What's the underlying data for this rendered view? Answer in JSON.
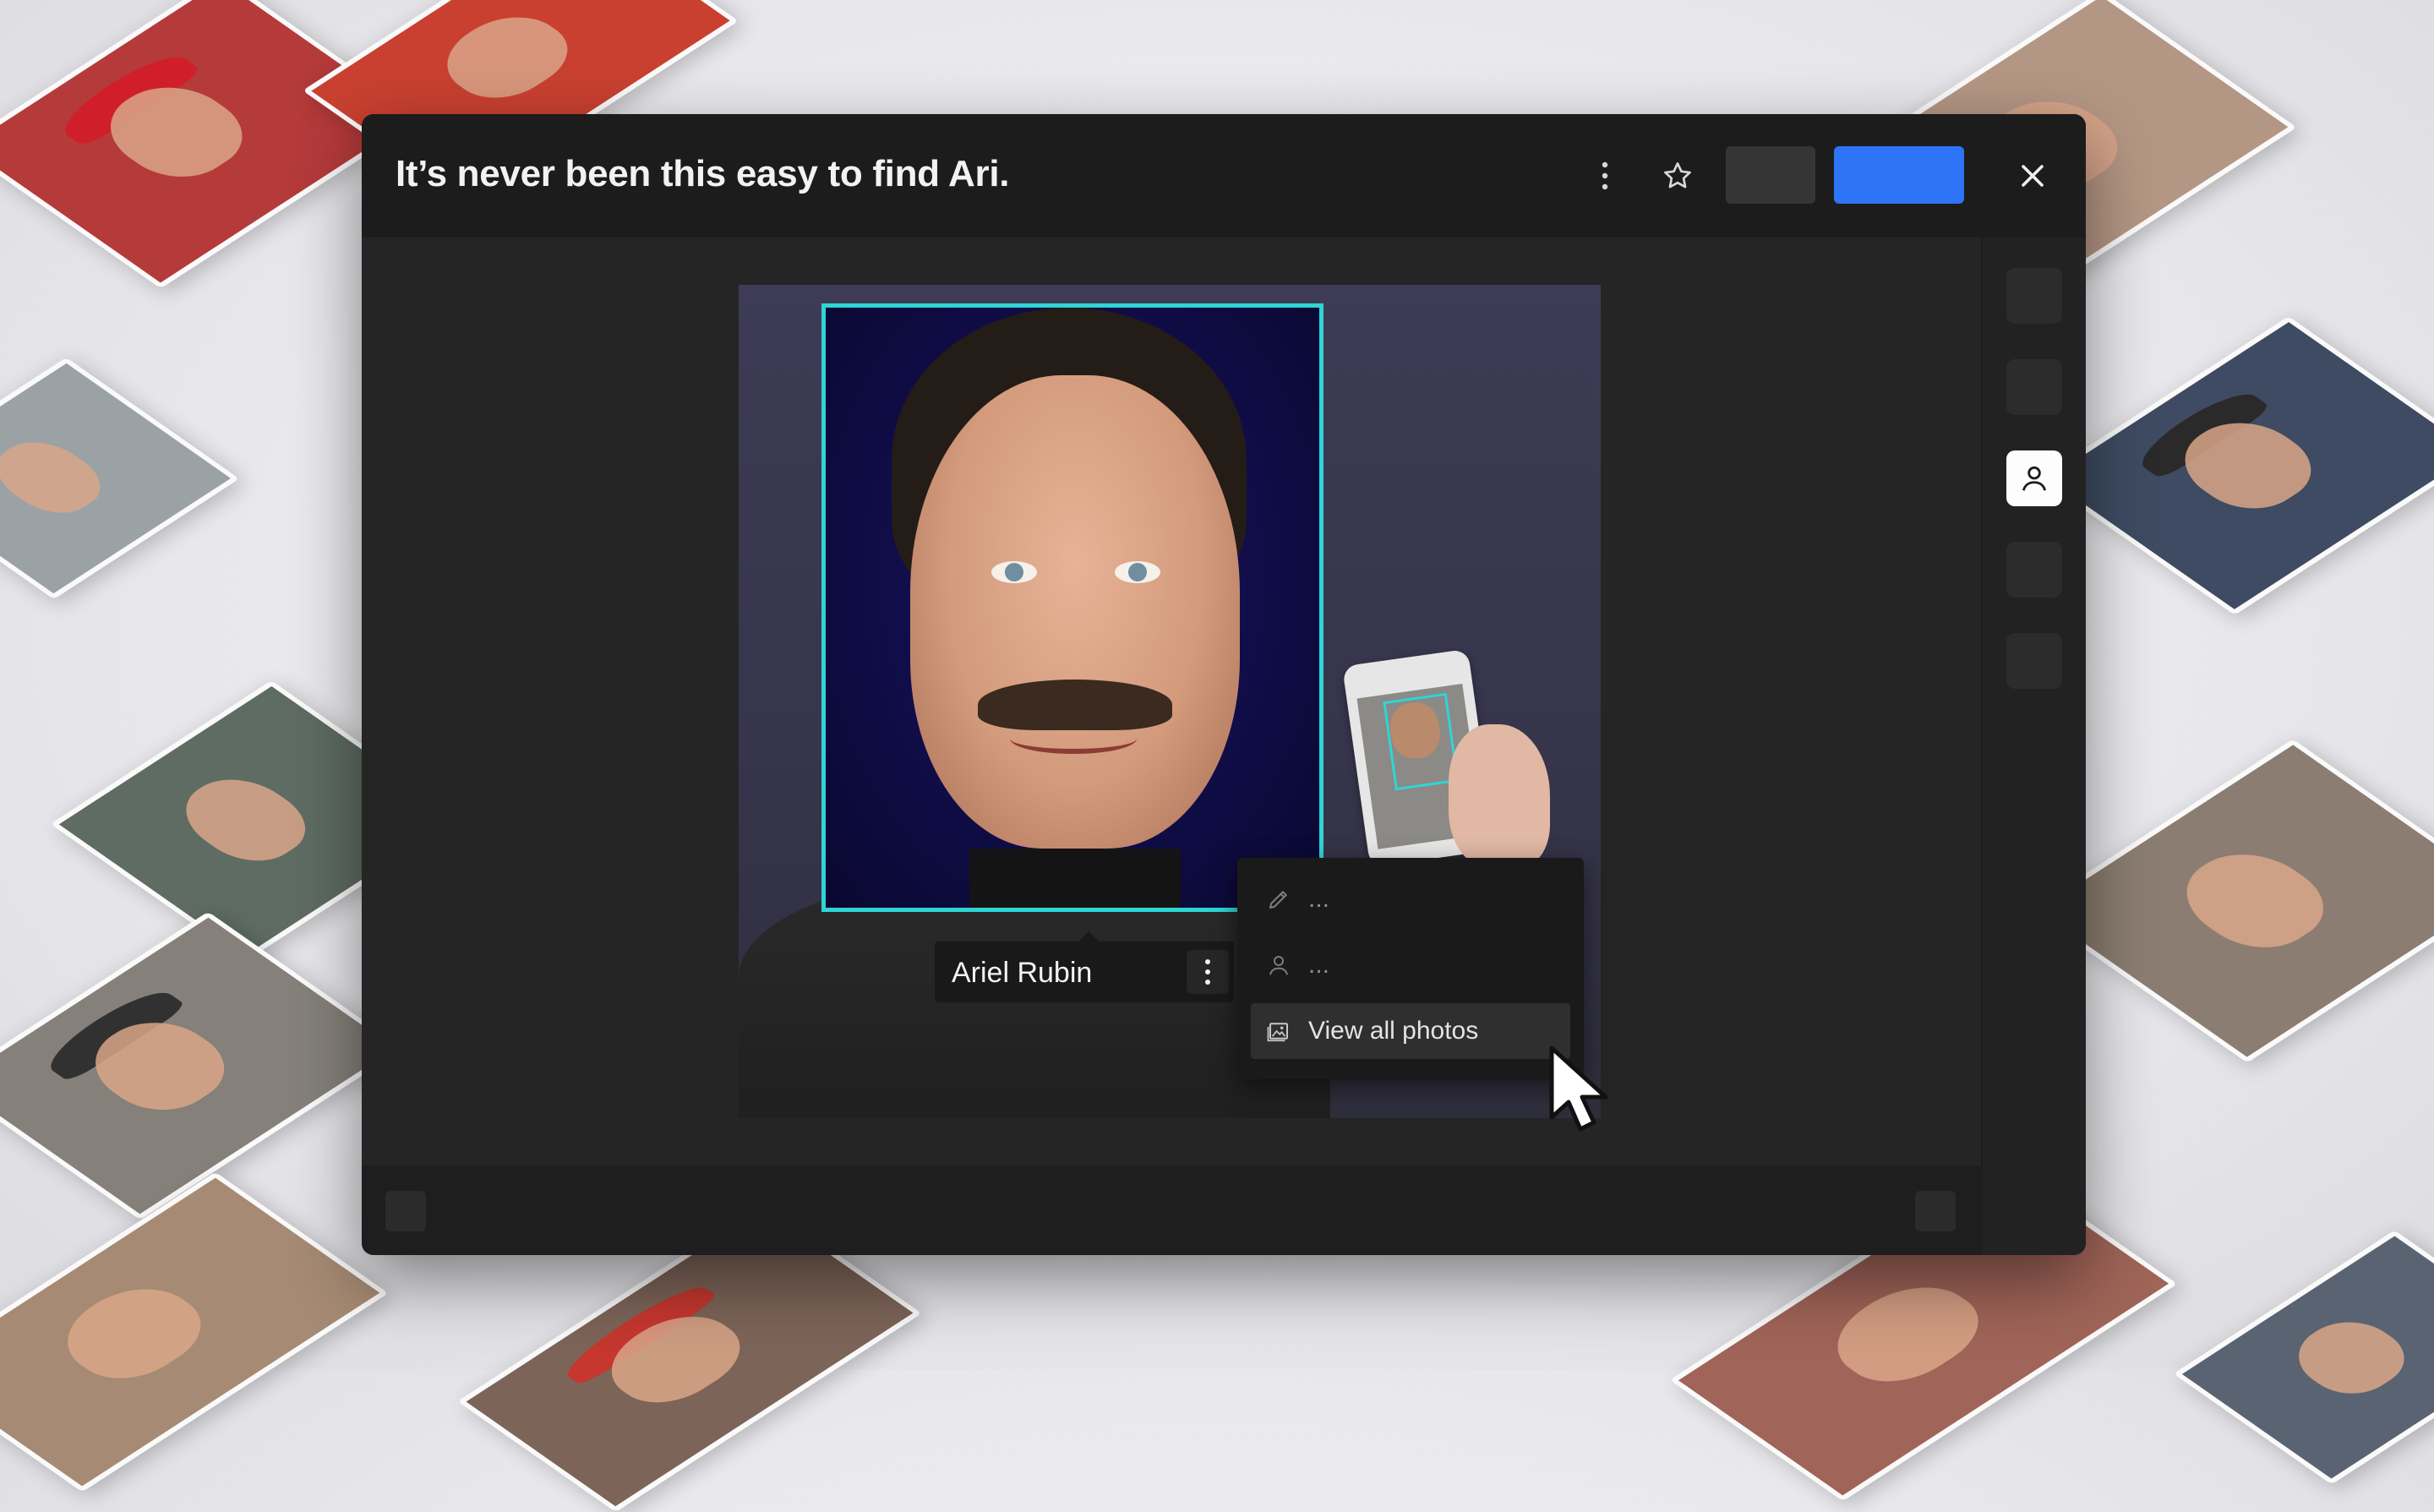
{
  "modal": {
    "title": "It’s never been this easy to find Ari."
  },
  "header_actions": {
    "more_icon": "vertical-ellipsis",
    "favorite_icon": "star-outline",
    "close_icon": "x-mark"
  },
  "sidebar": {
    "active_icon": "person-outline"
  },
  "face_tag": {
    "name": "Ariel Rubin",
    "options_icon": "vertical-ellipsis"
  },
  "context_menu": {
    "items": [
      {
        "icon": "pencil-icon",
        "label": "..."
      },
      {
        "icon": "person-icon",
        "label": "..."
      },
      {
        "icon": "photos-icon",
        "label": "View all photos"
      }
    ]
  },
  "colors": {
    "accent_blue": "#2d74f6",
    "face_box": "#2fd5d5"
  }
}
